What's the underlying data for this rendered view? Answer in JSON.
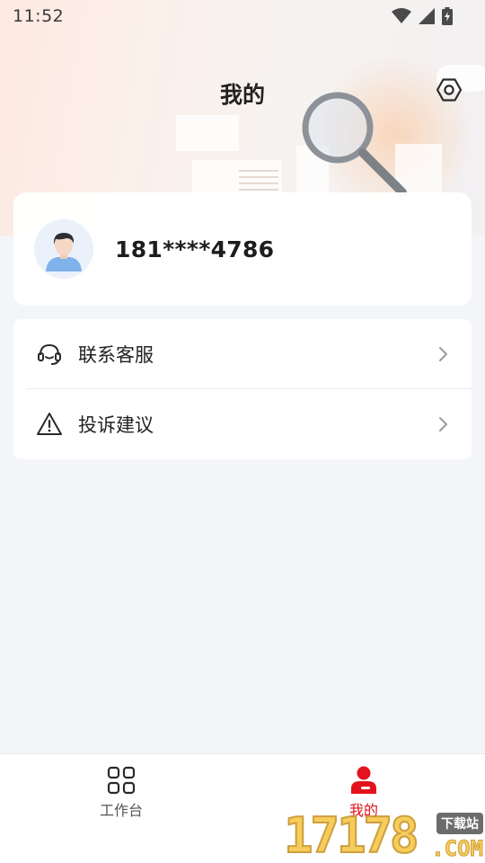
{
  "status_bar": {
    "time": "11:52"
  },
  "header": {
    "title": "我的"
  },
  "profile": {
    "phone": "181****4786"
  },
  "menu": {
    "items": [
      {
        "label": "联系客服",
        "icon": "headset-icon"
      },
      {
        "label": "投诉建议",
        "icon": "warning-triangle-icon"
      }
    ]
  },
  "bottom_nav": {
    "items": [
      {
        "label": "工作台",
        "icon": "grid-icon",
        "active": false
      },
      {
        "label": "我的",
        "icon": "person-icon",
        "active": true
      }
    ]
  },
  "watermark": {
    "number": "17178",
    "tag": "下载站",
    "domain": ".COM"
  },
  "colors": {
    "accent": "#e4121c",
    "background": "#f4f5f9",
    "card": "#ffffff"
  }
}
